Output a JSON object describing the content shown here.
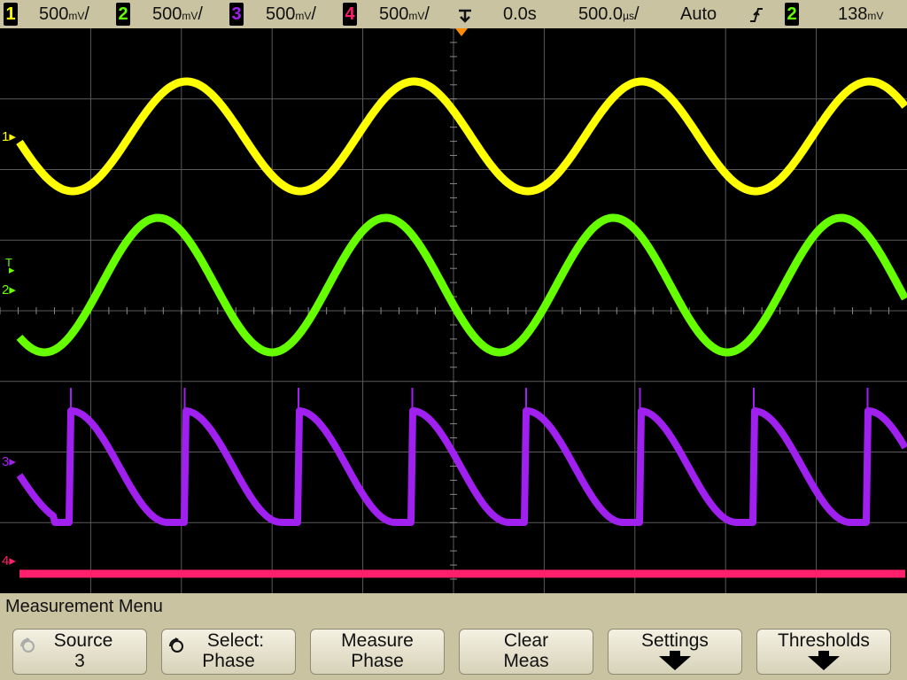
{
  "status_bar": {
    "channels": [
      {
        "num": "1",
        "scale": "500",
        "unit": "mV",
        "suffix": "/",
        "color": "#ffff00"
      },
      {
        "num": "2",
        "scale": "500",
        "unit": "mV",
        "suffix": "/",
        "color": "#66ff00"
      },
      {
        "num": "3",
        "scale": "500",
        "unit": "mV",
        "suffix": "/",
        "color": "#a020f0"
      },
      {
        "num": "4",
        "scale": "500",
        "unit": "mV",
        "suffix": "/",
        "color": "#ff1f6b"
      }
    ],
    "trigger_mode_icon": "trigger-edge-icon",
    "delay": "0.0s",
    "timebase": "500.0",
    "timebase_unit": "µs",
    "timebase_suffix": "/",
    "sweep": "Auto",
    "slope_icon": "rising-edge-icon",
    "trigger_source": "2",
    "trigger_level": "138",
    "trigger_level_unit": "mV"
  },
  "markers": {
    "ch1": "1",
    "trig": "T",
    "ch2": "2",
    "ch3": "3",
    "ch4": "4"
  },
  "colors": {
    "ch1": "#ffff00",
    "ch2": "#66ff00",
    "ch3": "#a020f0",
    "ch4": "#ff1f6b",
    "grid": "#5a5a5a",
    "trigger_marker": "#ff8c00"
  },
  "menu": {
    "title": "Measurement Menu",
    "softkeys": [
      {
        "line1": "Source",
        "line2": "3"
      },
      {
        "line1": "Select:",
        "line2": "Phase"
      },
      {
        "line1": "Measure",
        "line2": "Phase"
      },
      {
        "line1": "Clear",
        "line2": "Meas"
      },
      {
        "line1": "Settings",
        "line2": ""
      },
      {
        "line1": "Thresholds",
        "line2": ""
      }
    ]
  }
}
